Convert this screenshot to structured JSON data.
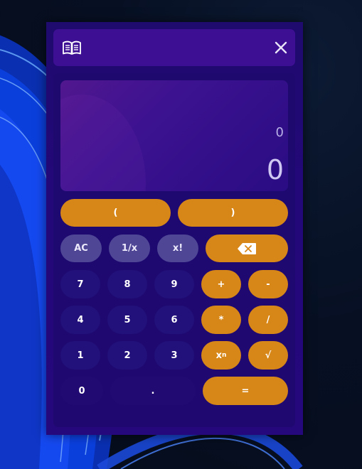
{
  "app": {
    "close_icon": "close-icon",
    "history_icon": "book-icon"
  },
  "display": {
    "expression": "0",
    "result": "0"
  },
  "keypad": {
    "open_paren": "(",
    "close_paren": ")",
    "clear": "AC",
    "reciprocal": "1/x",
    "factorial": "x!",
    "backspace_icon": "backspace-icon",
    "digits": [
      "0",
      "1",
      "2",
      "3",
      "4",
      "5",
      "6",
      "7",
      "8",
      "9"
    ],
    "decimal": ".",
    "plus": "+",
    "minus": "-",
    "multiply": "*",
    "divide": "/",
    "power_base": "x",
    "power_exp": "n",
    "sqrt": "√",
    "equals": "="
  },
  "colors": {
    "accent": "#d78717",
    "function_button": "#4f4796",
    "digit_button": "#22117a",
    "window_bg": "#23087a",
    "titlebar_bg": "#3c0f93"
  }
}
